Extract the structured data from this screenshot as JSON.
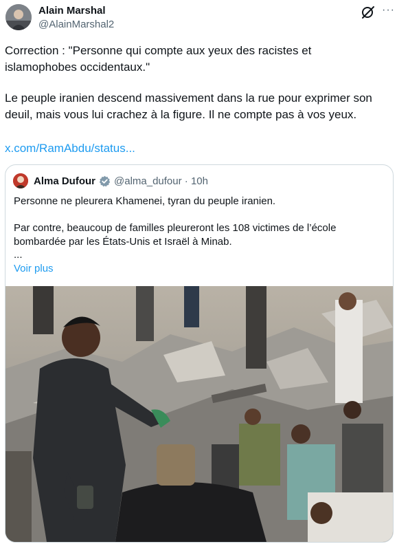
{
  "author": {
    "name": "Alain Marshal",
    "handle": "@AlainMarshal2",
    "avatar_icon": "profile-photo-icon"
  },
  "icons": {
    "grok": "grok-icon",
    "more": "more-options-icon"
  },
  "tweet": {
    "line1": "Correction : \"Personne qui compte aux yeux des racistes et",
    "line2": "islamophobes occidentaux.\"",
    "line3": "Le peuple iranien descend massivement dans la rue pour exprimer son",
    "line4": "deuil, mais vous lui crachez à la figure. Il ne compte pas à vos yeux.",
    "link": "x.com/RamAbdu/status..."
  },
  "quoted": {
    "name": "Alma Dufour",
    "verified": true,
    "handle": "@alma_dufour",
    "separator": "·",
    "time": "10h",
    "text1": "Personne ne pleurera Khamenei, tyran du peuple iranien.",
    "text2a": "Par contre, beaucoup de familles pleureront les 108 victimes de l’école",
    "text2b": "bombardée par les États-Unis et Israël à Minab.",
    "ellipsis": "...",
    "show_more": "Voir plus"
  },
  "colors": {
    "link": "#1d9bf0",
    "secondary_text": "#536471",
    "border": "#cfd9de"
  }
}
